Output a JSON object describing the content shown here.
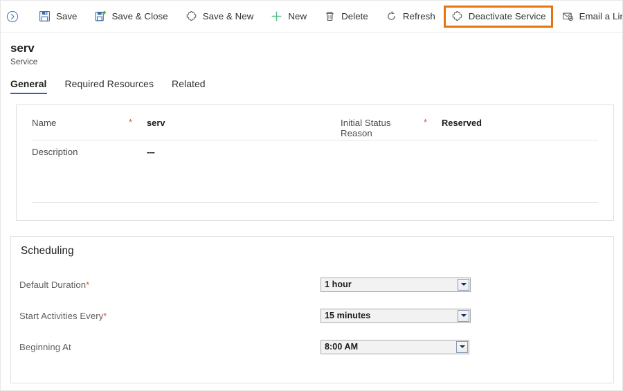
{
  "commandbar": {
    "expand_icon": "chevron-right-circle-icon",
    "overflow_label": "more-commands",
    "buttons": [
      {
        "label": "Save",
        "icon": "save-floppy-icon",
        "highlighted": false
      },
      {
        "label": "Save & Close",
        "icon": "save-and-close-icon",
        "highlighted": false
      },
      {
        "label": "Save & New",
        "icon": "save-and-new-icon",
        "highlighted": false
      },
      {
        "label": "New",
        "icon": "plus-icon",
        "highlighted": false
      },
      {
        "label": "Delete",
        "icon": "trash-icon",
        "highlighted": false
      },
      {
        "label": "Refresh",
        "icon": "refresh-icon",
        "highlighted": false
      },
      {
        "label": "Deactivate Service",
        "icon": "deactivate-icon",
        "highlighted": true
      },
      {
        "label": "Email a Link",
        "icon": "email-link-icon",
        "highlighted": false
      }
    ]
  },
  "record": {
    "title": "serv",
    "subtitle": "Service"
  },
  "tabs": [
    {
      "label": "General",
      "active": true
    },
    {
      "label": "Required Resources",
      "active": false
    },
    {
      "label": "Related",
      "active": false
    }
  ],
  "general": {
    "name": {
      "label": "Name",
      "required": "*",
      "value": "serv"
    },
    "initial_status_reason": {
      "label": "Initial Status Reason",
      "required": "*",
      "value": "Reserved"
    },
    "description": {
      "label": "Description",
      "value": "---"
    }
  },
  "scheduling": {
    "title": "Scheduling",
    "fields": [
      {
        "label": "Default Duration",
        "required": "*",
        "value": "1 hour"
      },
      {
        "label": "Start Activities Every",
        "required": "*",
        "value": "15 minutes"
      },
      {
        "label": "Beginning At",
        "required": "",
        "value": "8:00 AM"
      }
    ]
  },
  "colors": {
    "highlight": "#E8730C",
    "tab_accent": "#2266CC",
    "required_star": "#E8483C",
    "new_icon_green": "#5FBE8A",
    "icon_gray": "#605E5C",
    "save_icon_blue": "#3A6FA8"
  }
}
